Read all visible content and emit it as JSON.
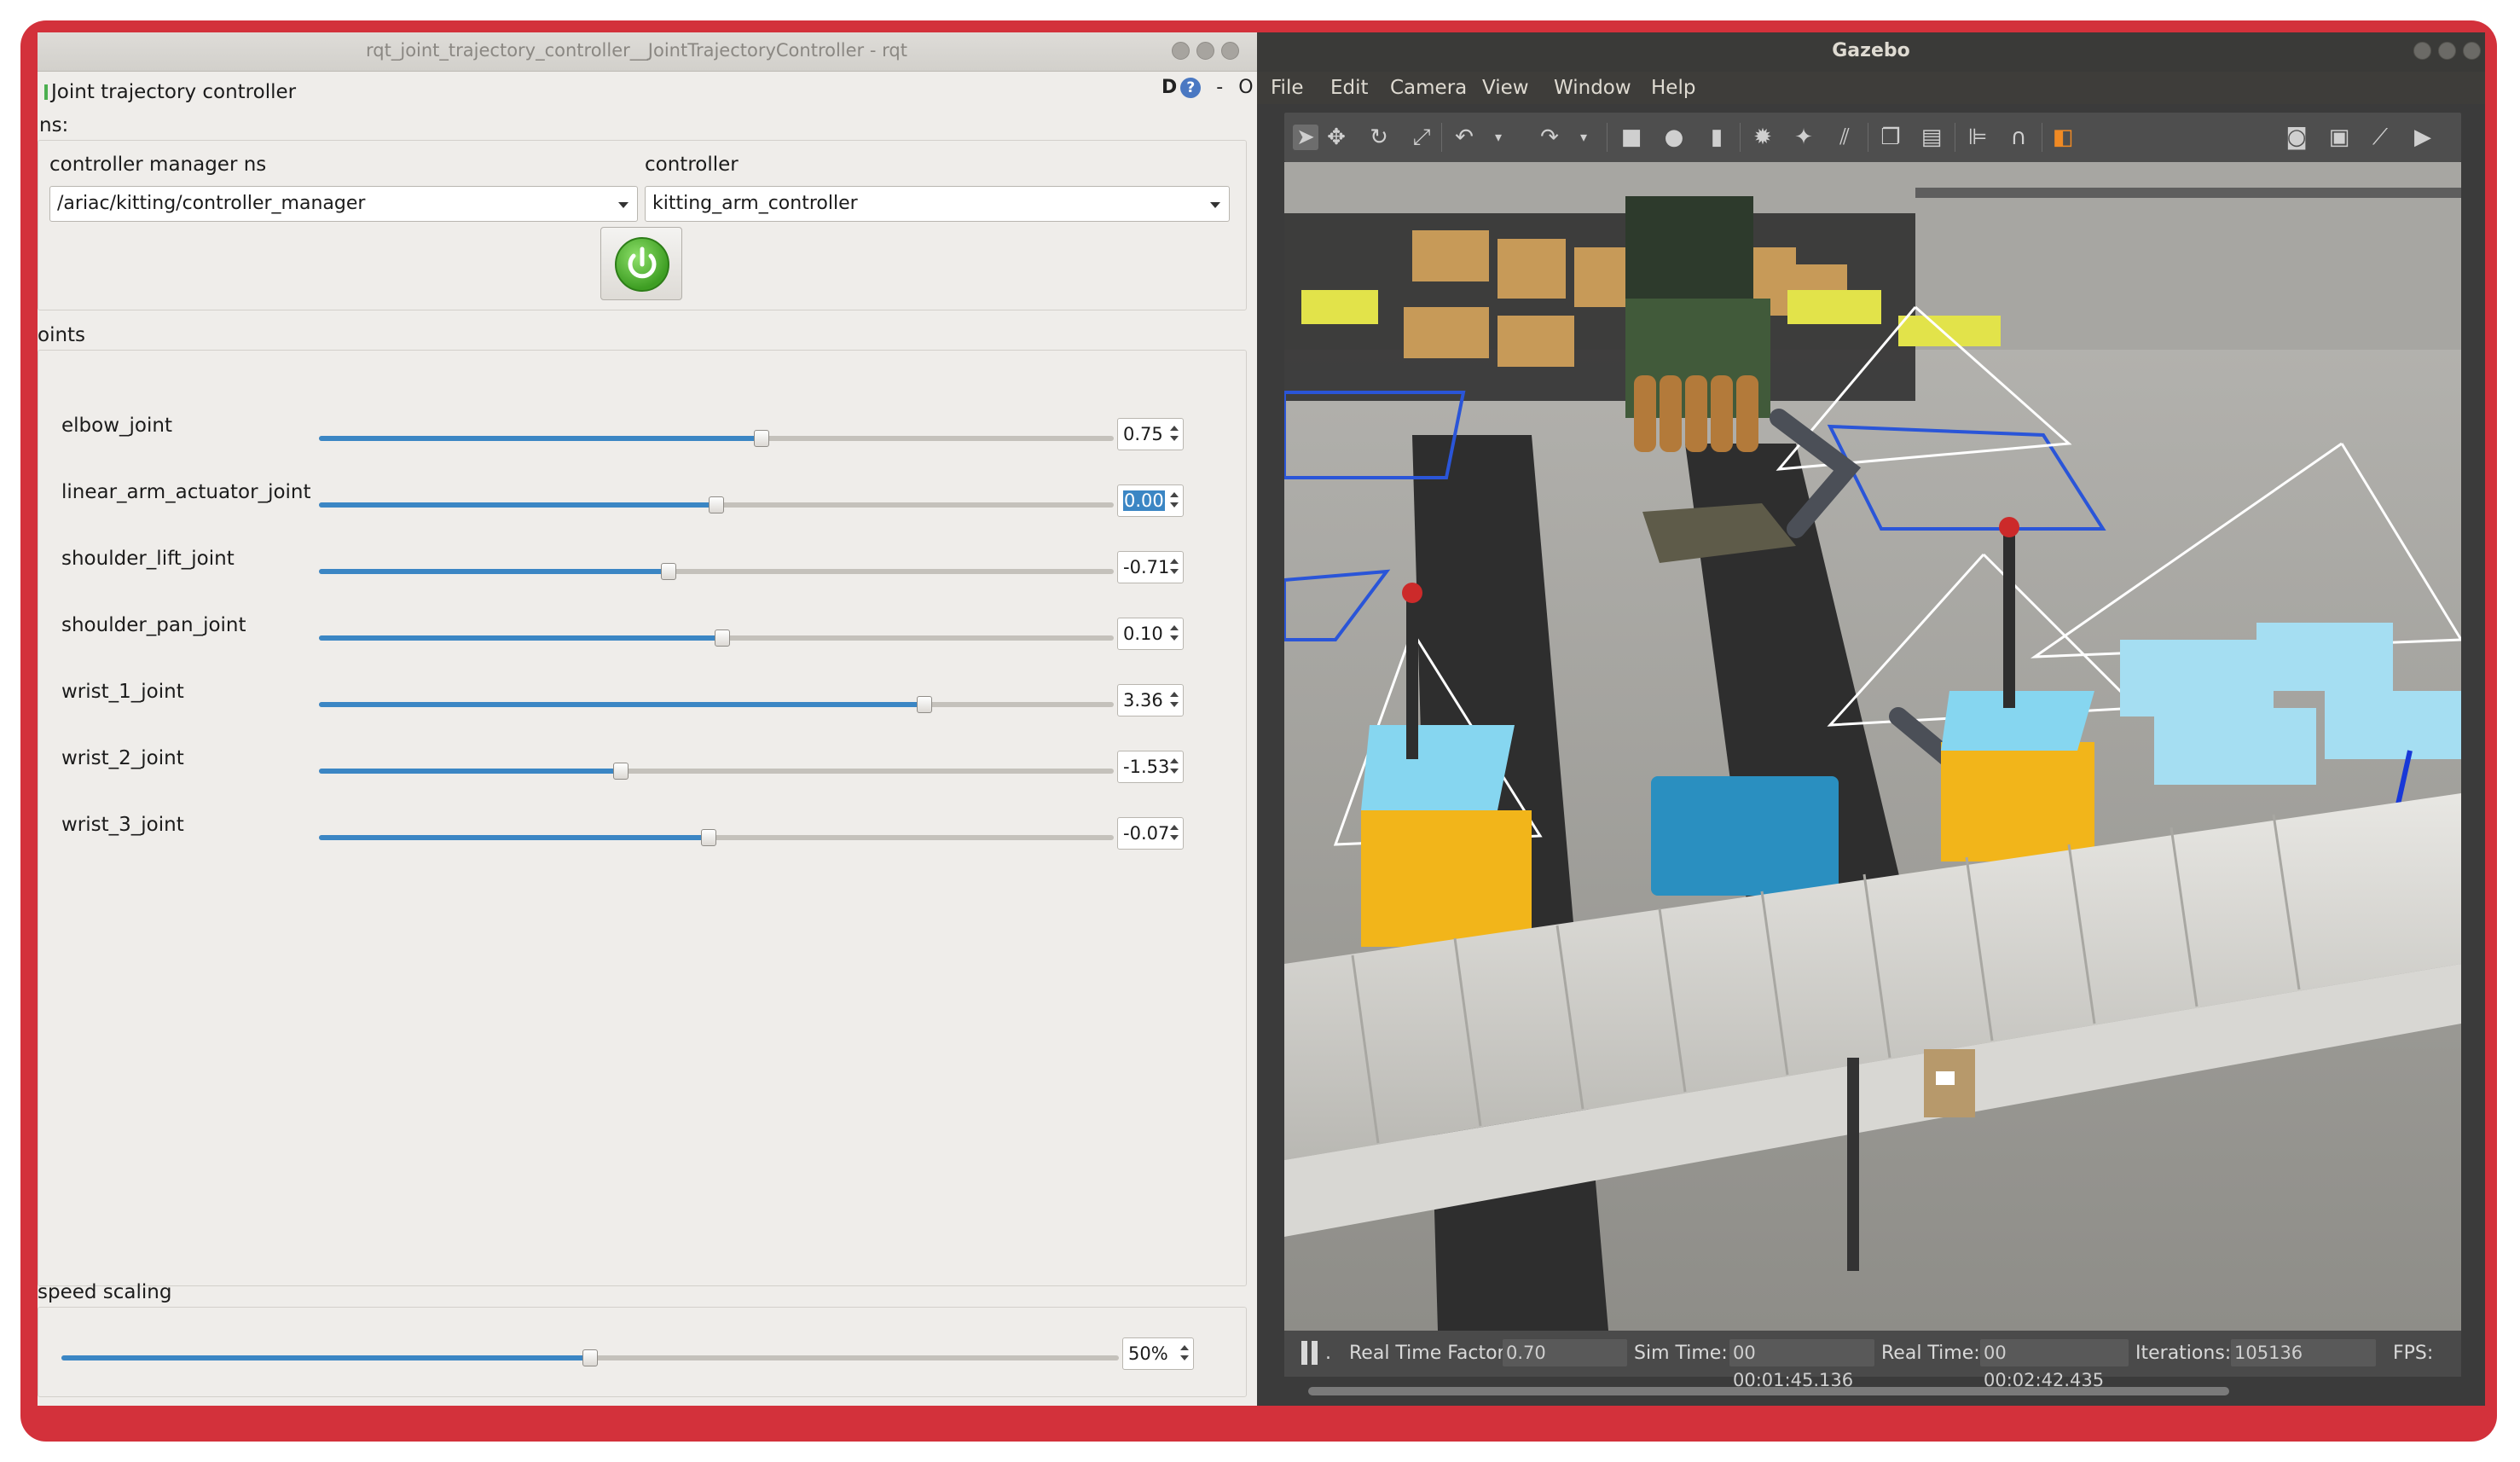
{
  "rqt": {
    "window_title": "rqt_joint_trajectory_controller__JointTrajectoryController - rqt",
    "plugin_title": "Joint trajectory controller",
    "ns_label": "ns:",
    "help_d": "D",
    "help_q": "?",
    "help_minus": "-",
    "help_o": "O",
    "controller_manager_label": "controller manager ns",
    "controller_manager_value": "/ariac/kitting/controller_manager",
    "controller_label": "controller",
    "controller_value": "kitting_arm_controller",
    "joints_label": "oints",
    "speed_scaling_label": "speed scaling",
    "speed_scaling_value": "50%",
    "speed_scaling_fraction": 0.5,
    "joints": [
      {
        "name": "elbow_joint",
        "value": "0.75",
        "fraction": 0.557
      },
      {
        "name": "linear_arm_actuator_joint",
        "value": "0.00",
        "fraction": 0.5,
        "selected": true
      },
      {
        "name": "shoulder_lift_joint",
        "value": "-0.71",
        "fraction": 0.44
      },
      {
        "name": "shoulder_pan_joint",
        "value": "0.10",
        "fraction": 0.507
      },
      {
        "name": "wrist_1_joint",
        "value": "3.36",
        "fraction": 0.762
      },
      {
        "name": "wrist_2_joint",
        "value": "-1.53",
        "fraction": 0.38
      },
      {
        "name": "wrist_3_joint",
        "value": "-0.07",
        "fraction": 0.49
      }
    ]
  },
  "gazebo": {
    "window_title": "Gazebo",
    "menus": [
      "File",
      "Edit",
      "Camera",
      "View",
      "Window",
      "Help"
    ],
    "stats": {
      "real_time_factor_label": "Real Time Factor:",
      "real_time_factor": "0.70",
      "sim_time_label": "Sim Time:",
      "sim_time": "00 00:01:45.136",
      "real_time_label": "Real Time:",
      "real_time": "00 00:02:42.435",
      "iterations_label": "Iterations:",
      "iterations": "105136",
      "fps_label": "FPS:",
      "pause_dot": "."
    }
  },
  "colors": {
    "frame_red": "#d3313b",
    "slider_blue": "#3b86c4",
    "power_green": "#4caf50"
  }
}
